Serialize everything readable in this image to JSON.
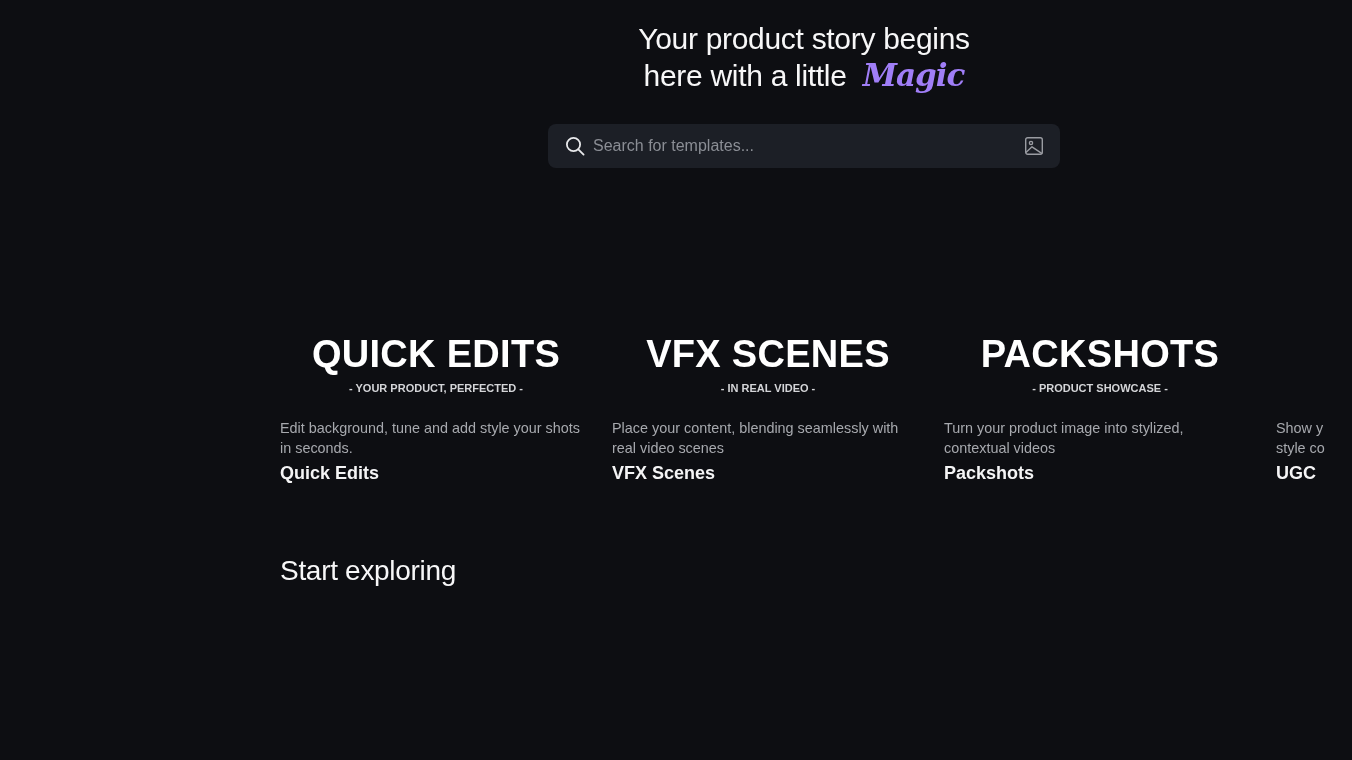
{
  "hero": {
    "headline_lines": [
      "Your product story begins",
      "here with a little **Magic**"
    ]
  },
  "search": {
    "placeholder": "Search for templates..."
  },
  "categories": [
    {
      "heading": "QUICK EDITS",
      "tagline": "- YOUR PRODUCT, PERFECTED -",
      "description_lines": [
        "Edit background, tune and add style your shots",
        "in seconds."
      ],
      "title": "Quick Edits"
    },
    {
      "heading": "VFX SCENES",
      "tagline": "- IN REAL VIDEO -",
      "description_lines": [
        "Place your content, blending seamlessly with",
        "real video scenes"
      ],
      "title": "VFX Scenes"
    },
    {
      "heading": "PACKSHOTS",
      "tagline": "- PRODUCT SHOWCASE -",
      "description_lines": [
        "Turn your product image into stylized,",
        "contextual videos"
      ],
      "title": "Packshots"
    },
    {
      "description_lines": [
        "Show y",
        "style co"
      ],
      "title": "UGC"
    }
  ],
  "section": {
    "title": "Start exploring"
  }
}
